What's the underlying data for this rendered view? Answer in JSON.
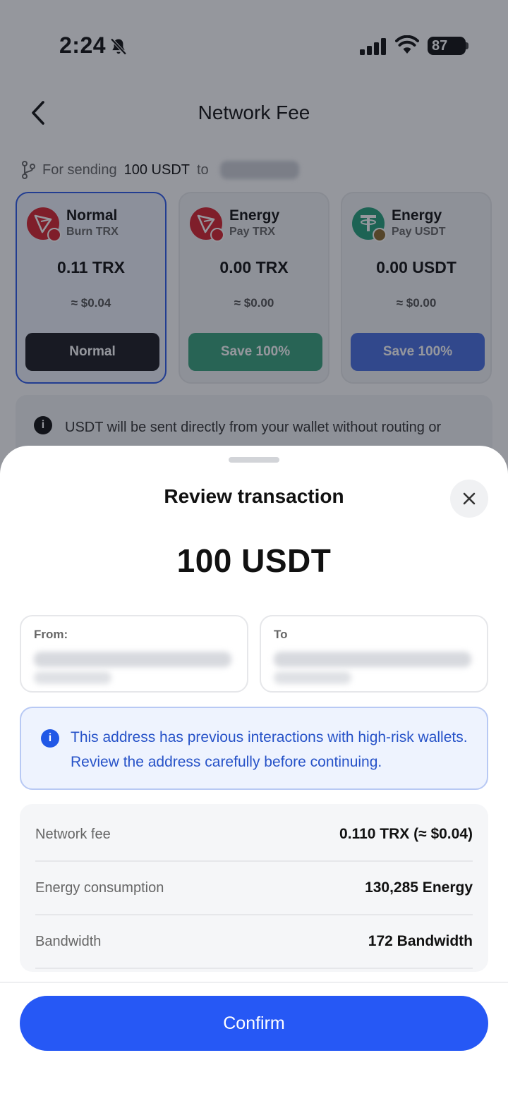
{
  "status_bar": {
    "time": "2:24",
    "battery": "87"
  },
  "header": {
    "title": "Network Fee"
  },
  "sending": {
    "prefix": "For sending",
    "amount": "100 USDT",
    "to": "to"
  },
  "fee_options": [
    {
      "title": "Normal",
      "subtitle": "Burn TRX",
      "amount": "0.11 TRX",
      "usd": "≈ $0.04",
      "button": "Normal",
      "button_color": "#1c1d22",
      "selected": true
    },
    {
      "title": "Energy",
      "subtitle": "Pay TRX",
      "amount": "0.00 TRX",
      "usd": "≈ $0.00",
      "button": "Save 100%",
      "button_color": "#3aa37d",
      "selected": false
    },
    {
      "title": "Energy",
      "subtitle": "Pay USDT",
      "amount": "0.00 USDT",
      "usd": "≈ $0.00",
      "button": "Save 100%",
      "button_color": "#4a6fe0",
      "selected": false
    }
  ],
  "info_strip": {
    "text": "USDT will be sent directly from your wallet without routing or swaps."
  },
  "sheet": {
    "title": "Review transaction",
    "amount": "100 USDT",
    "from_label": "From:",
    "to_label": "To",
    "warning": "This address has previous interactions with high-risk wallets. Review the address carefully before continuing.",
    "details": [
      {
        "label": "Network fee",
        "value": "0.110 TRX (≈ $0.04)"
      },
      {
        "label": "Energy consumption",
        "value": "130,285 Energy"
      },
      {
        "label": "Bandwidth",
        "value": "172 Bandwidth"
      }
    ],
    "confirm_label": "Confirm"
  },
  "colors": {
    "accent": "#2658f5",
    "tron_red": "#d7232f",
    "tether_green": "#26a17b",
    "warning_text": "#2652c8"
  }
}
